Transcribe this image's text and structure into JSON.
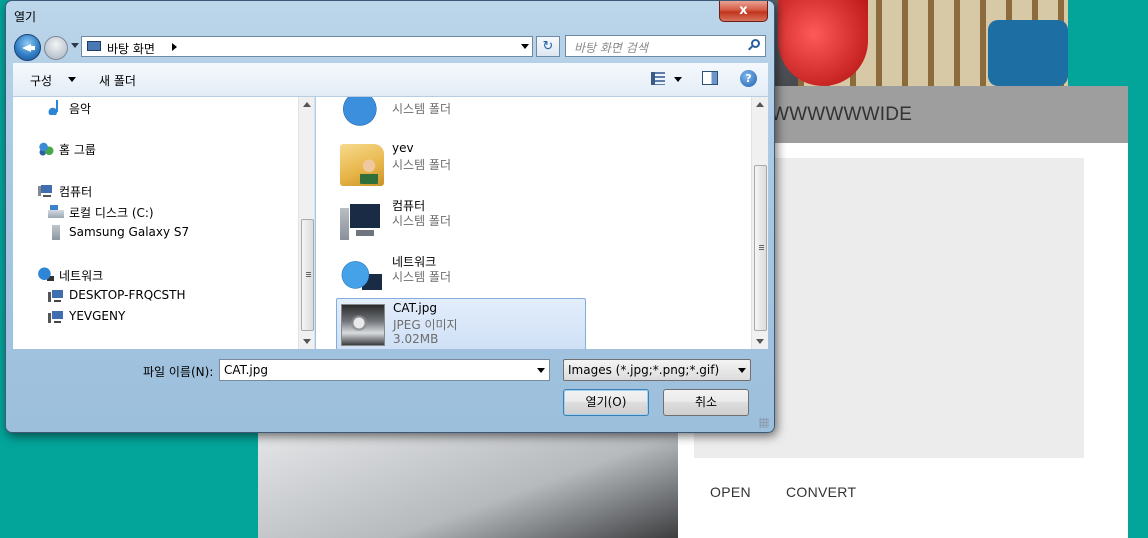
{
  "app": {
    "title": "WWWWWWIDE",
    "buttons": {
      "open": "OPEN",
      "convert": "CONVERT"
    }
  },
  "dialog": {
    "title": "열기",
    "close_glyph": "x",
    "address": {
      "crumb": "바탕 화면"
    },
    "search_placeholder": "바탕 화면 검색",
    "toolbar": {
      "organize": "구성",
      "new_folder": "새 폴더",
      "help_glyph": "?"
    },
    "nav": {
      "items": [
        {
          "label": "음악",
          "icon": "music-icon"
        },
        {
          "label": "홈 그룹",
          "icon": "homegroup-icon"
        },
        {
          "label": "컴퓨터",
          "icon": "computer-icon"
        },
        {
          "label": "로컬 디스크 (C:)",
          "icon": "disk-icon"
        },
        {
          "label": "Samsung Galaxy S7",
          "icon": "phone-icon"
        },
        {
          "label": "네트워크",
          "icon": "network-icon"
        },
        {
          "label": "DESKTOP-FRQCSTH",
          "icon": "network-computer-icon"
        },
        {
          "label": "YEVGENY",
          "icon": "network-computer-icon"
        }
      ]
    },
    "files": [
      {
        "name": "",
        "type": "시스템 폴더",
        "icon": "network-icon"
      },
      {
        "name": "yev",
        "type": "시스템 폴더",
        "icon": "user-folder-icon"
      },
      {
        "name": "컴퓨터",
        "type": "시스템 폴더",
        "icon": "computer-icon"
      },
      {
        "name": "네트워크",
        "type": "시스템 폴더",
        "icon": "network-icon"
      },
      {
        "name": "CAT.jpg",
        "type": "JPEG 이미지",
        "size": "3.02MB",
        "icon": "image-thumbnail",
        "selected": true
      }
    ],
    "filename_label": "파일 이름(N):",
    "filename_value": "CAT.jpg",
    "filter_value": "Images (*.jpg;*.png;*.gif)",
    "open_button": "열기(O)",
    "cancel_button": "취소"
  }
}
